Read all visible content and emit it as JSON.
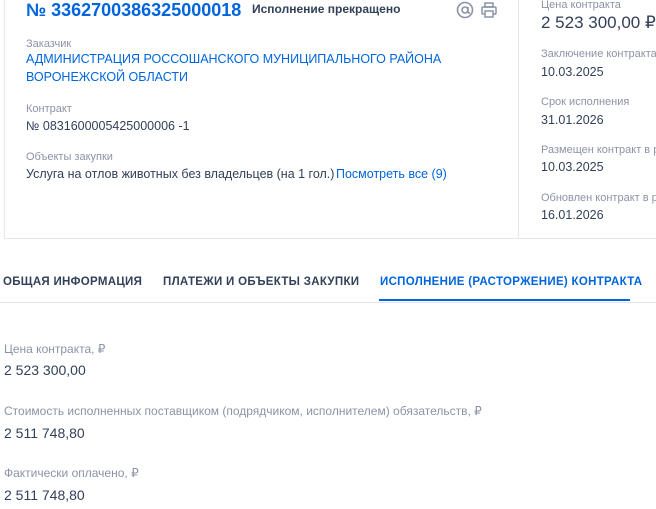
{
  "card": {
    "reg_number": "№ 3362700386325000018",
    "status": "Исполнение прекращено",
    "customer_label": "Заказчик",
    "customer_name": "АДМИНИСТРАЦИЯ РОССОШАНСКОГО МУНИЦИПАЛЬНОГО РАЙОНА ВОРОНЕЖСКОЙ ОБЛАСТИ",
    "contract_label": "Контракт",
    "contract_number": "№ 0831600005425000006 -1",
    "objects_label": "Объекты закупки",
    "objects_value": "Услуга на отлов животных без владельцев (на 1 гол.)",
    "objects_link": "Посмотреть все (9)"
  },
  "side": {
    "price_label": "Цена контракта",
    "price_value": "2 523 300,00 ₽",
    "conclusion_label": "Заключение контракта",
    "conclusion_date": "10.03.2025",
    "term_label": "Срок исполнения",
    "term_date": "31.01.2026",
    "placed_label": "Размещен контракт в ре",
    "placed_date": "10.03.2025",
    "updated_label": "Обновлен контракт в ре",
    "updated_date": "16.01.2026"
  },
  "tabs": [
    {
      "label": "ОБЩАЯ ИНФОРМАЦИЯ"
    },
    {
      "label": "ПЛАТЕЖИ И ОБЪЕКТЫ ЗАКУПКИ"
    },
    {
      "label": "ИСПОЛНЕНИЕ (РАСТОРЖЕНИЕ) КОНТРАКТА"
    }
  ],
  "active_tab": "ИСПОЛНЕНИЕ (РАСТОРЖЕНИЕ) КОНТРАКТА",
  "fields": [
    {
      "label": "Цена контракта, ₽",
      "value": "2 523 300,00"
    },
    {
      "label": "Стоимость исполненных поставщиком (подрядчиком, исполнителем) обязательств, ₽",
      "value": "2 511 748,80"
    },
    {
      "label": "Фактически оплачено, ₽",
      "value": "2 511 748,80"
    }
  ],
  "icons": [
    "email-icon",
    "print-icon"
  ],
  "colors": {
    "accent": "#0065dd",
    "text": "#334059",
    "muted": "#8c93a6",
    "border": "#e4e7f2"
  }
}
